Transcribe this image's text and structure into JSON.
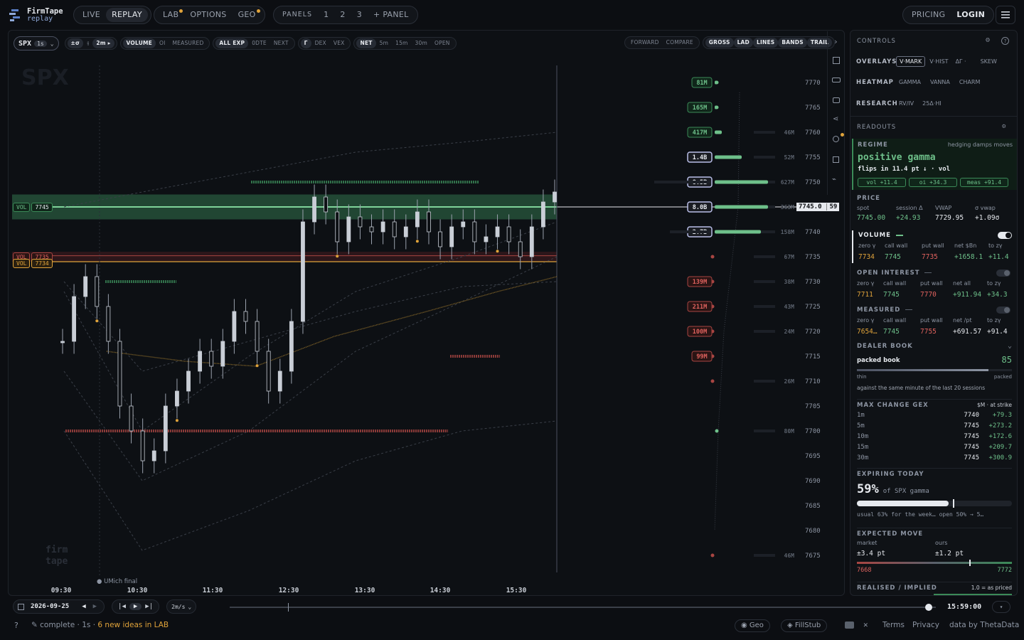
{
  "brand": {
    "name": "FirmTape",
    "sub": "replay"
  },
  "topnav": {
    "live": "LIVE",
    "replay": "REPLAY",
    "lab": "LAB",
    "options": "OPTIONS",
    "geo": "GEO",
    "panels": "PANELS",
    "p1": "1",
    "p2": "2",
    "p3": "3",
    "add_panel": "+ PANEL",
    "pricing": "PRICING",
    "login": "LOGIN"
  },
  "toolbar": {
    "symbol": "SPX",
    "interval": "1s",
    "pm": "±σ",
    "bars": "⫳",
    "range": "2m ▸",
    "grp1": [
      "VOLUME",
      "OI",
      "MEASURED"
    ],
    "grp2": [
      "ALL EXP",
      "0DTE",
      "NEXT"
    ],
    "grp3": [
      "Γ",
      "DEX",
      "VEX"
    ],
    "grp4": [
      "NET",
      "5m",
      "15m",
      "30m",
      "OPEN"
    ],
    "grp5": [
      "FORWARD",
      "COMPARE"
    ],
    "grp6": [
      "GROSS",
      "LAD",
      "LINES",
      "BANDS",
      "TRAIL"
    ]
  },
  "chart": {
    "watermark": "SPX",
    "vol_levels": [
      {
        "tag": "VOL",
        "price": "7745"
      },
      {
        "tag": "VOL",
        "price": "7735"
      },
      {
        "tag": "VOL",
        "price": "7734"
      }
    ],
    "event": "UMich final",
    "logo": {
      "l1": "firm",
      "l2": "tape"
    },
    "cursor": {
      "price": "7745.0",
      "sec": "59"
    }
  },
  "chart_data": {
    "type": "line",
    "x": [
      "09:30",
      "10:30",
      "11:30",
      "12:30",
      "13:30",
      "14:30",
      "15:30"
    ],
    "y_ticks": [
      7770,
      7765,
      7760,
      7755,
      7750,
      7745,
      7740,
      7735,
      7730,
      7725,
      7720,
      7715,
      7710,
      7705,
      7700,
      7695,
      7690,
      7685,
      7680,
      7675
    ],
    "ylim": [
      7673,
      7773
    ],
    "price": [
      7718,
      7727,
      7731,
      7725,
      7718,
      7705,
      7700,
      7694,
      7696,
      7705,
      7708,
      7712,
      7716,
      7713,
      7718,
      7724,
      7722,
      7716,
      7708,
      7712,
      7722,
      7742,
      7747,
      7744,
      7738,
      7743,
      7741,
      7740,
      7742,
      7739,
      7741,
      7744,
      7740,
      7737,
      7741,
      7742,
      7738,
      7739,
      7741,
      7738,
      7735,
      7741,
      7746,
      7748
    ],
    "gex_ladder": [
      {
        "strike": 7770,
        "label": "81M",
        "side": "pos",
        "gross": ""
      },
      {
        "strike": 7765,
        "label": "165M",
        "side": "pos",
        "gross": ""
      },
      {
        "strike": 7760,
        "label": "417M",
        "side": "pos",
        "gross": "46M"
      },
      {
        "strike": 7755,
        "label": "1.4B",
        "side": "pos",
        "gross": "52M"
      },
      {
        "strike": 7750,
        "label": "8.5B",
        "side": "pos",
        "gross": "627M"
      },
      {
        "strike": 7745,
        "label": "8.0B",
        "side": "pos",
        "gross": "363M"
      },
      {
        "strike": 7740,
        "label": "2.7B",
        "side": "pos",
        "gross": "158M"
      },
      {
        "strike": 7735,
        "label": "",
        "side": "neg",
        "gross": "67M"
      },
      {
        "strike": 7730,
        "label": "139M",
        "side": "neg",
        "gross": "38M"
      },
      {
        "strike": 7725,
        "label": "211M",
        "side": "neg",
        "gross": "43M"
      },
      {
        "strike": 7720,
        "label": "100M",
        "side": "neg",
        "gross": "24M"
      },
      {
        "strike": 7715,
        "label": "99M",
        "side": "neg",
        "gross": ""
      },
      {
        "strike": 7710,
        "label": "",
        "side": "neg",
        "gross": "26M"
      },
      {
        "strike": 7700,
        "label": "",
        "side": "pos",
        "gross": "80M"
      },
      {
        "strike": 7675,
        "label": "",
        "side": "neg",
        "gross": "46M"
      }
    ]
  },
  "right": {
    "controls": "CONTROLS",
    "overlays": {
      "label": "OVERLAYS",
      "items": [
        "V·MARK",
        "V·HIST",
        "ΔΓ ·",
        "SKEW"
      ]
    },
    "heatmap": {
      "label": "HEATMAP",
      "items": [
        "GAMMA",
        "VANNA",
        "CHARM"
      ]
    },
    "research": {
      "label": "RESEARCH",
      "items": [
        "RV/IV",
        "25Δ·HI"
      ]
    },
    "readouts": "READOUTS",
    "regime": {
      "label": "REGIME",
      "note": "hedging damps moves",
      "value": "positive gamma",
      "flip": "flips in 11.4 pt ↓ · vol",
      "chips": [
        "vol +11.4",
        "oi +34.3",
        "meas +91.4"
      ]
    },
    "price": {
      "label": "PRICE",
      "h": [
        "spot",
        "session Δ",
        "VWAP",
        "σ vwap"
      ],
      "v": [
        "7745.00",
        "+24.93",
        "7729.95",
        "+1.09σ"
      ]
    },
    "volume": {
      "label": "VOLUME",
      "h": [
        "zero γ",
        "call wall",
        "put wall",
        "net $Bn",
        "to zγ"
      ],
      "v": [
        "7734",
        "7745",
        "7735",
        "+1658.1",
        "+11.4"
      ]
    },
    "oi": {
      "label": "OPEN INTEREST",
      "h": [
        "zero γ",
        "call wall",
        "put wall",
        "net all",
        "to zγ"
      ],
      "v": [
        "7711",
        "7745",
        "7770",
        "+911.94",
        "+34.3"
      ]
    },
    "measured": {
      "label": "MEASURED",
      "h": [
        "zero γ",
        "call wall",
        "put wall",
        "net /pt",
        "to zγ"
      ],
      "v": [
        "7654…",
        "7745",
        "7755",
        "+691.57",
        "+91.4"
      ]
    },
    "dealer": {
      "label": "DEALER BOOK",
      "state": "packed book",
      "score": "85",
      "thin": "thin",
      "packed": "packed",
      "fill": 0.85,
      "note": "against the same minute of the last 20 sessions"
    },
    "maxgex": {
      "label": "MAX CHANGE GEX",
      "unit": "$M · at strike",
      "rows": [
        [
          "1m",
          "7740",
          "+79.3"
        ],
        [
          "5m",
          "7745",
          "+273.2"
        ],
        [
          "10m",
          "7745",
          "+172.6"
        ],
        [
          "15m",
          "7745",
          "+209.7"
        ],
        [
          "30m",
          "7745",
          "+300.9"
        ]
      ]
    },
    "expiring": {
      "label": "EXPIRING TODAY",
      "pct": "59%",
      "of": "of SPX gamma",
      "fill": 0.59,
      "note": "usual 63% for the week… open 50% → 5…"
    },
    "expected": {
      "label": "EXPECTED MOVE",
      "market": "market",
      "ours": "ours",
      "mv": "±3.4 pt",
      "ov": "±1.2 pt",
      "lo": "7668",
      "hi": "7772"
    },
    "realised": {
      "label": "REALISED / IMPLIED",
      "note": "1.0 = as priced"
    }
  },
  "bottom": {
    "date": "2026-09-25",
    "speed": "2m/s",
    "time": "15:59:00",
    "progress": 0.99
  },
  "status": {
    "help": "?",
    "text": "complete · 1s ·",
    "ideas": "6 new ideas in LAB",
    "geo": "Geo",
    "fill": "FillStub",
    "terms": "Terms",
    "privacy": "Privacy",
    "data": "data by ThetaData"
  }
}
